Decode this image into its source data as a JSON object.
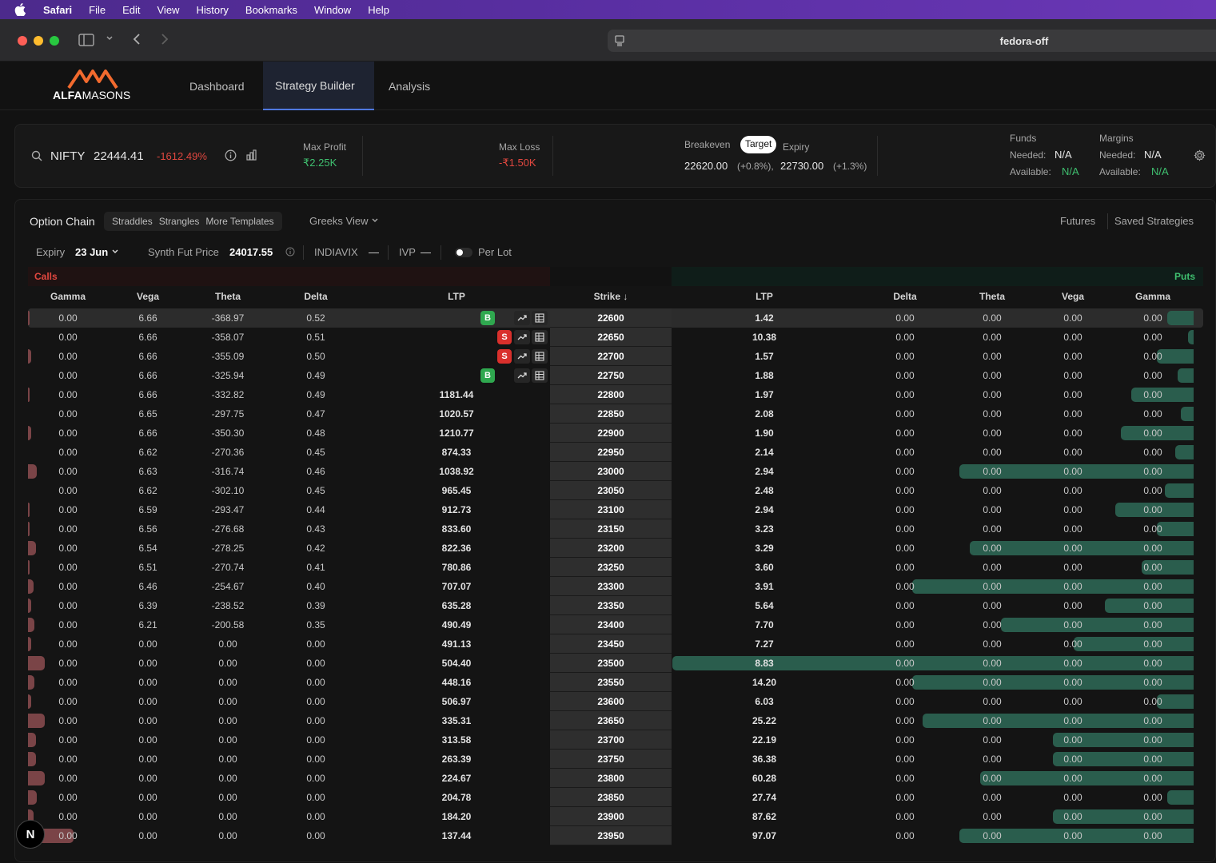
{
  "menubar": {
    "items": [
      "Safari",
      "File",
      "Edit",
      "View",
      "History",
      "Bookmarks",
      "Window",
      "Help"
    ]
  },
  "browser": {
    "url": "fedora-off"
  },
  "brand": {
    "logo_text_bold": "ALFA",
    "logo_text": "MASONS",
    "accent": "#f26a2e"
  },
  "nav": {
    "tabs": [
      "Dashboard",
      "Strategy Builder",
      "Analysis"
    ],
    "active": "Strategy Builder"
  },
  "summary": {
    "symbol": "NIFTY",
    "price": "22444.41",
    "change": "-1612.49%",
    "max_profit_label": "Max Profit",
    "max_profit": "₹2.25K",
    "max_loss_label": "Max Loss",
    "max_loss": "-₹1.50K",
    "breakeven_label": "Breakeven",
    "target_label": "Target",
    "expiry_label": "Expiry",
    "be1": "22620.00",
    "be1_pct": "(+0.8%),",
    "be2": "22730.00",
    "be2_pct": "(+1.3%)",
    "funds_label": "Funds",
    "margins_label": "Margins",
    "needed_label": "Needed:",
    "available_label": "Available:",
    "funds_needed": "N/A",
    "funds_available": "N/A",
    "margins_needed": "N/A",
    "margins_available": "N/A",
    "colors": {
      "profit": "#3fbf6f",
      "loss": "#e0473f"
    }
  },
  "toolbar": {
    "option_chain": "Option Chain",
    "templates": [
      "Straddles",
      "Strangles",
      "More Templates"
    ],
    "greeks_view": "Greeks View",
    "futures": "Futures",
    "saved": "Saved Strategies",
    "expiry_label": "Expiry",
    "expiry_value": "23 Jun",
    "synth_label": "Synth Fut Price",
    "synth_value": "24017.55",
    "indiavix_label": "INDIAVIX",
    "indiavix_value": "—",
    "ivp_label": "IVP",
    "ivp_value": "—",
    "per_lot": "Per Lot"
  },
  "chain": {
    "calls_label": "Calls",
    "puts_label": "Puts",
    "call_headers": [
      "Gamma",
      "Vega",
      "Theta",
      "Delta",
      "LTP"
    ],
    "strike_header": "Strike ↓",
    "put_headers": [
      "LTP",
      "Delta",
      "Theta",
      "Vega",
      "Gamma"
    ],
    "rows": [
      {
        "strike": "22600",
        "c_gamma": "0.00",
        "c_vega": "6.66",
        "c_theta": "-368.97",
        "c_delta": "0.52",
        "c_ltp": "",
        "p_ltp": "1.42",
        "p_delta": "0.00",
        "p_theta": "0.00",
        "p_vega": "0.00",
        "p_gamma": "0.00",
        "badge": "B",
        "oi_call": 0.005,
        "oi_put": 0.05
      },
      {
        "strike": "22650",
        "c_gamma": "0.00",
        "c_vega": "6.66",
        "c_theta": "-358.07",
        "c_delta": "0.51",
        "c_ltp": "",
        "p_ltp": "10.38",
        "p_delta": "0.00",
        "p_theta": "0.00",
        "p_vega": "0.00",
        "p_gamma": "0.00",
        "badge": "S",
        "oi_call": 0.0,
        "oi_put": 0.01
      },
      {
        "strike": "22700",
        "c_gamma": "0.00",
        "c_vega": "6.66",
        "c_theta": "-355.09",
        "c_delta": "0.50",
        "c_ltp": "",
        "p_ltp": "1.57",
        "p_delta": "0.00",
        "p_theta": "0.00",
        "p_vega": "0.00",
        "p_gamma": "0.00",
        "badge": "S",
        "oi_call": 0.02,
        "oi_put": 0.07
      },
      {
        "strike": "22750",
        "c_gamma": "0.00",
        "c_vega": "6.66",
        "c_theta": "-325.94",
        "c_delta": "0.49",
        "c_ltp": "",
        "p_ltp": "1.88",
        "p_delta": "0.00",
        "p_theta": "0.00",
        "p_vega": "0.00",
        "p_gamma": "0.00",
        "badge": "B",
        "oi_call": 0.0,
        "oi_put": 0.03
      },
      {
        "strike": "22800",
        "c_gamma": "0.00",
        "c_vega": "6.66",
        "c_theta": "-332.82",
        "c_delta": "0.49",
        "c_ltp": "1181.44",
        "p_ltp": "1.97",
        "p_delta": "0.00",
        "p_theta": "0.00",
        "p_vega": "0.00",
        "p_gamma": "0.00",
        "badge": "",
        "oi_call": 0.01,
        "oi_put": 0.12
      },
      {
        "strike": "22850",
        "c_gamma": "0.00",
        "c_vega": "6.65",
        "c_theta": "-297.75",
        "c_delta": "0.47",
        "c_ltp": "1020.57",
        "p_ltp": "2.08",
        "p_delta": "0.00",
        "p_theta": "0.00",
        "p_vega": "0.00",
        "p_gamma": "0.00",
        "badge": "",
        "oi_call": 0.0,
        "oi_put": 0.025
      },
      {
        "strike": "22900",
        "c_gamma": "0.00",
        "c_vega": "6.66",
        "c_theta": "-350.30",
        "c_delta": "0.48",
        "c_ltp": "1210.77",
        "p_ltp": "1.90",
        "p_delta": "0.00",
        "p_theta": "0.00",
        "p_vega": "0.00",
        "p_gamma": "0.00",
        "badge": "",
        "oi_call": 0.02,
        "oi_put": 0.14
      },
      {
        "strike": "22950",
        "c_gamma": "0.00",
        "c_vega": "6.62",
        "c_theta": "-270.36",
        "c_delta": "0.45",
        "c_ltp": "874.33",
        "p_ltp": "2.14",
        "p_delta": "0.00",
        "p_theta": "0.00",
        "p_vega": "0.00",
        "p_gamma": "0.00",
        "badge": "",
        "oi_call": 0.0,
        "oi_put": 0.035
      },
      {
        "strike": "23000",
        "c_gamma": "0.00",
        "c_vega": "6.63",
        "c_theta": "-316.74",
        "c_delta": "0.46",
        "c_ltp": "1038.92",
        "p_ltp": "2.94",
        "p_delta": "0.00",
        "p_theta": "0.00",
        "p_vega": "0.00",
        "p_gamma": "0.00",
        "badge": "",
        "oi_call": 0.06,
        "oi_put": 0.45
      },
      {
        "strike": "23050",
        "c_gamma": "0.00",
        "c_vega": "6.62",
        "c_theta": "-302.10",
        "c_delta": "0.45",
        "c_ltp": "965.45",
        "p_ltp": "2.48",
        "p_delta": "0.00",
        "p_theta": "0.00",
        "p_vega": "0.00",
        "p_gamma": "0.00",
        "badge": "",
        "oi_call": 0.0,
        "oi_put": 0.055
      },
      {
        "strike": "23100",
        "c_gamma": "0.00",
        "c_vega": "6.59",
        "c_theta": "-293.47",
        "c_delta": "0.44",
        "c_ltp": "912.73",
        "p_ltp": "2.94",
        "p_delta": "0.00",
        "p_theta": "0.00",
        "p_vega": "0.00",
        "p_gamma": "0.00",
        "badge": "",
        "oi_call": 0.01,
        "oi_put": 0.15
      },
      {
        "strike": "23150",
        "c_gamma": "0.00",
        "c_vega": "6.56",
        "c_theta": "-276.68",
        "c_delta": "0.43",
        "c_ltp": "833.60",
        "p_ltp": "3.23",
        "p_delta": "0.00",
        "p_theta": "0.00",
        "p_vega": "0.00",
        "p_gamma": "0.00",
        "badge": "",
        "oi_call": 0.005,
        "oi_put": 0.07
      },
      {
        "strike": "23200",
        "c_gamma": "0.00",
        "c_vega": "6.54",
        "c_theta": "-278.25",
        "c_delta": "0.42",
        "c_ltp": "822.36",
        "p_ltp": "3.29",
        "p_delta": "0.00",
        "p_theta": "0.00",
        "p_vega": "0.00",
        "p_gamma": "0.00",
        "badge": "",
        "oi_call": 0.05,
        "oi_put": 0.43
      },
      {
        "strike": "23250",
        "c_gamma": "0.00",
        "c_vega": "6.51",
        "c_theta": "-270.74",
        "c_delta": "0.41",
        "c_ltp": "780.86",
        "p_ltp": "3.60",
        "p_delta": "0.00",
        "p_theta": "0.00",
        "p_vega": "0.00",
        "p_gamma": "0.00",
        "badge": "",
        "oi_call": 0.01,
        "oi_put": 0.1
      },
      {
        "strike": "23300",
        "c_gamma": "0.00",
        "c_vega": "6.46",
        "c_theta": "-254.67",
        "c_delta": "0.40",
        "c_ltp": "707.07",
        "p_ltp": "3.91",
        "p_delta": "0.00",
        "p_theta": "0.00",
        "p_vega": "0.00",
        "p_gamma": "0.00",
        "badge": "",
        "oi_call": 0.035,
        "oi_put": 0.54
      },
      {
        "strike": "23350",
        "c_gamma": "0.00",
        "c_vega": "6.39",
        "c_theta": "-238.52",
        "c_delta": "0.39",
        "c_ltp": "635.28",
        "p_ltp": "5.64",
        "p_delta": "0.00",
        "p_theta": "0.00",
        "p_vega": "0.00",
        "p_gamma": "0.00",
        "badge": "",
        "oi_call": 0.02,
        "oi_put": 0.17
      },
      {
        "strike": "23400",
        "c_gamma": "0.00",
        "c_vega": "6.21",
        "c_theta": "-200.58",
        "c_delta": "0.35",
        "c_ltp": "490.49",
        "p_ltp": "7.70",
        "p_delta": "0.00",
        "p_theta": "0.00",
        "p_vega": "0.00",
        "p_gamma": "0.00",
        "badge": "",
        "oi_call": 0.04,
        "oi_put": 0.37
      },
      {
        "strike": "23450",
        "c_gamma": "0.00",
        "c_vega": "0.00",
        "c_theta": "0.00",
        "c_delta": "0.00",
        "c_ltp": "491.13",
        "p_ltp": "7.27",
        "p_delta": "0.00",
        "p_theta": "0.00",
        "p_vega": "0.00",
        "p_gamma": "0.00",
        "badge": "",
        "oi_call": 0.02,
        "oi_put": 0.23
      },
      {
        "strike": "23500",
        "c_gamma": "0.00",
        "c_vega": "0.00",
        "c_theta": "0.00",
        "c_delta": "0.00",
        "c_ltp": "504.40",
        "p_ltp": "8.83",
        "p_delta": "0.00",
        "p_theta": "0.00",
        "p_vega": "0.00",
        "p_gamma": "0.00",
        "badge": "",
        "oi_call": 0.11,
        "oi_put": 1.0
      },
      {
        "strike": "23550",
        "c_gamma": "0.00",
        "c_vega": "0.00",
        "c_theta": "0.00",
        "c_delta": "0.00",
        "c_ltp": "448.16",
        "p_ltp": "14.20",
        "p_delta": "0.00",
        "p_theta": "0.00",
        "p_vega": "0.00",
        "p_gamma": "0.00",
        "badge": "",
        "oi_call": 0.04,
        "oi_put": 0.54
      },
      {
        "strike": "23600",
        "c_gamma": "0.00",
        "c_vega": "0.00",
        "c_theta": "0.00",
        "c_delta": "0.00",
        "c_ltp": "506.97",
        "p_ltp": "6.03",
        "p_delta": "0.00",
        "p_theta": "0.00",
        "p_vega": "0.00",
        "p_gamma": "0.00",
        "badge": "",
        "oi_call": 0.02,
        "oi_put": 0.07
      },
      {
        "strike": "23650",
        "c_gamma": "0.00",
        "c_vega": "0.00",
        "c_theta": "0.00",
        "c_delta": "0.00",
        "c_ltp": "335.31",
        "p_ltp": "25.22",
        "p_delta": "0.00",
        "p_theta": "0.00",
        "p_vega": "0.00",
        "p_gamma": "0.00",
        "badge": "",
        "oi_call": 0.11,
        "oi_put": 0.52
      },
      {
        "strike": "23700",
        "c_gamma": "0.00",
        "c_vega": "0.00",
        "c_theta": "0.00",
        "c_delta": "0.00",
        "c_ltp": "313.58",
        "p_ltp": "22.19",
        "p_delta": "0.00",
        "p_theta": "0.00",
        "p_vega": "0.00",
        "p_gamma": "0.00",
        "badge": "",
        "oi_call": 0.05,
        "oi_put": 0.27
      },
      {
        "strike": "23750",
        "c_gamma": "0.00",
        "c_vega": "0.00",
        "c_theta": "0.00",
        "c_delta": "0.00",
        "c_ltp": "263.39",
        "p_ltp": "36.38",
        "p_delta": "0.00",
        "p_theta": "0.00",
        "p_vega": "0.00",
        "p_gamma": "0.00",
        "badge": "",
        "oi_call": 0.05,
        "oi_put": 0.27
      },
      {
        "strike": "23800",
        "c_gamma": "0.00",
        "c_vega": "0.00",
        "c_theta": "0.00",
        "c_delta": "0.00",
        "c_ltp": "224.67",
        "p_ltp": "60.28",
        "p_delta": "0.00",
        "p_theta": "0.00",
        "p_vega": "0.00",
        "p_gamma": "0.00",
        "badge": "",
        "oi_call": 0.11,
        "oi_put": 0.41
      },
      {
        "strike": "23850",
        "c_gamma": "0.00",
        "c_vega": "0.00",
        "c_theta": "0.00",
        "c_delta": "0.00",
        "c_ltp": "204.78",
        "p_ltp": "27.74",
        "p_delta": "0.00",
        "p_theta": "0.00",
        "p_vega": "0.00",
        "p_gamma": "0.00",
        "badge": "",
        "oi_call": 0.06,
        "oi_put": 0.05
      },
      {
        "strike": "23900",
        "c_gamma": "0.00",
        "c_vega": "0.00",
        "c_theta": "0.00",
        "c_delta": "0.00",
        "c_ltp": "184.20",
        "p_ltp": "87.62",
        "p_delta": "0.00",
        "p_theta": "0.00",
        "p_vega": "0.00",
        "p_gamma": "0.00",
        "badge": "",
        "oi_call": 0.035,
        "oi_put": 0.27
      },
      {
        "strike": "23950",
        "c_gamma": "0.00",
        "c_vega": "0.00",
        "c_theta": "0.00",
        "c_delta": "0.00",
        "c_ltp": "137.44",
        "p_ltp": "97.07",
        "p_delta": "0.00",
        "p_theta": "0.00",
        "p_vega": "0.00",
        "p_gamma": "0.00",
        "badge": "",
        "oi_call": 0.3,
        "oi_put": 0.45
      }
    ]
  },
  "dev_badge": "N"
}
